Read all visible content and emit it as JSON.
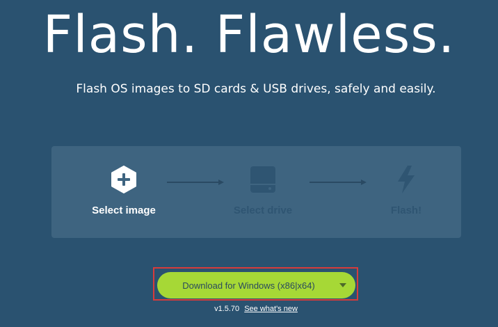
{
  "hero": {
    "title": "Flash. Flawless.",
    "subtitle": "Flash OS images to SD cards & USB drives, safely and easily."
  },
  "steps": [
    {
      "label": "Select image",
      "icon": "plus-hexagon-icon",
      "state": "active"
    },
    {
      "label": "Select drive",
      "icon": "hard-drive-icon",
      "state": "disabled"
    },
    {
      "label": "Flash!",
      "icon": "lightning-bolt-icon",
      "state": "disabled"
    }
  ],
  "download": {
    "label": "Download for Windows (x86|x64)",
    "caret_icon": "caret-down-icon"
  },
  "version": {
    "number": "v1.5.70",
    "whats_new_link": "See what's new"
  },
  "colors": {
    "background": "#2a5270",
    "panel": "#3e6480",
    "muted": "#2f5572",
    "button": "#a6d836",
    "highlight": "#d83b3b"
  }
}
